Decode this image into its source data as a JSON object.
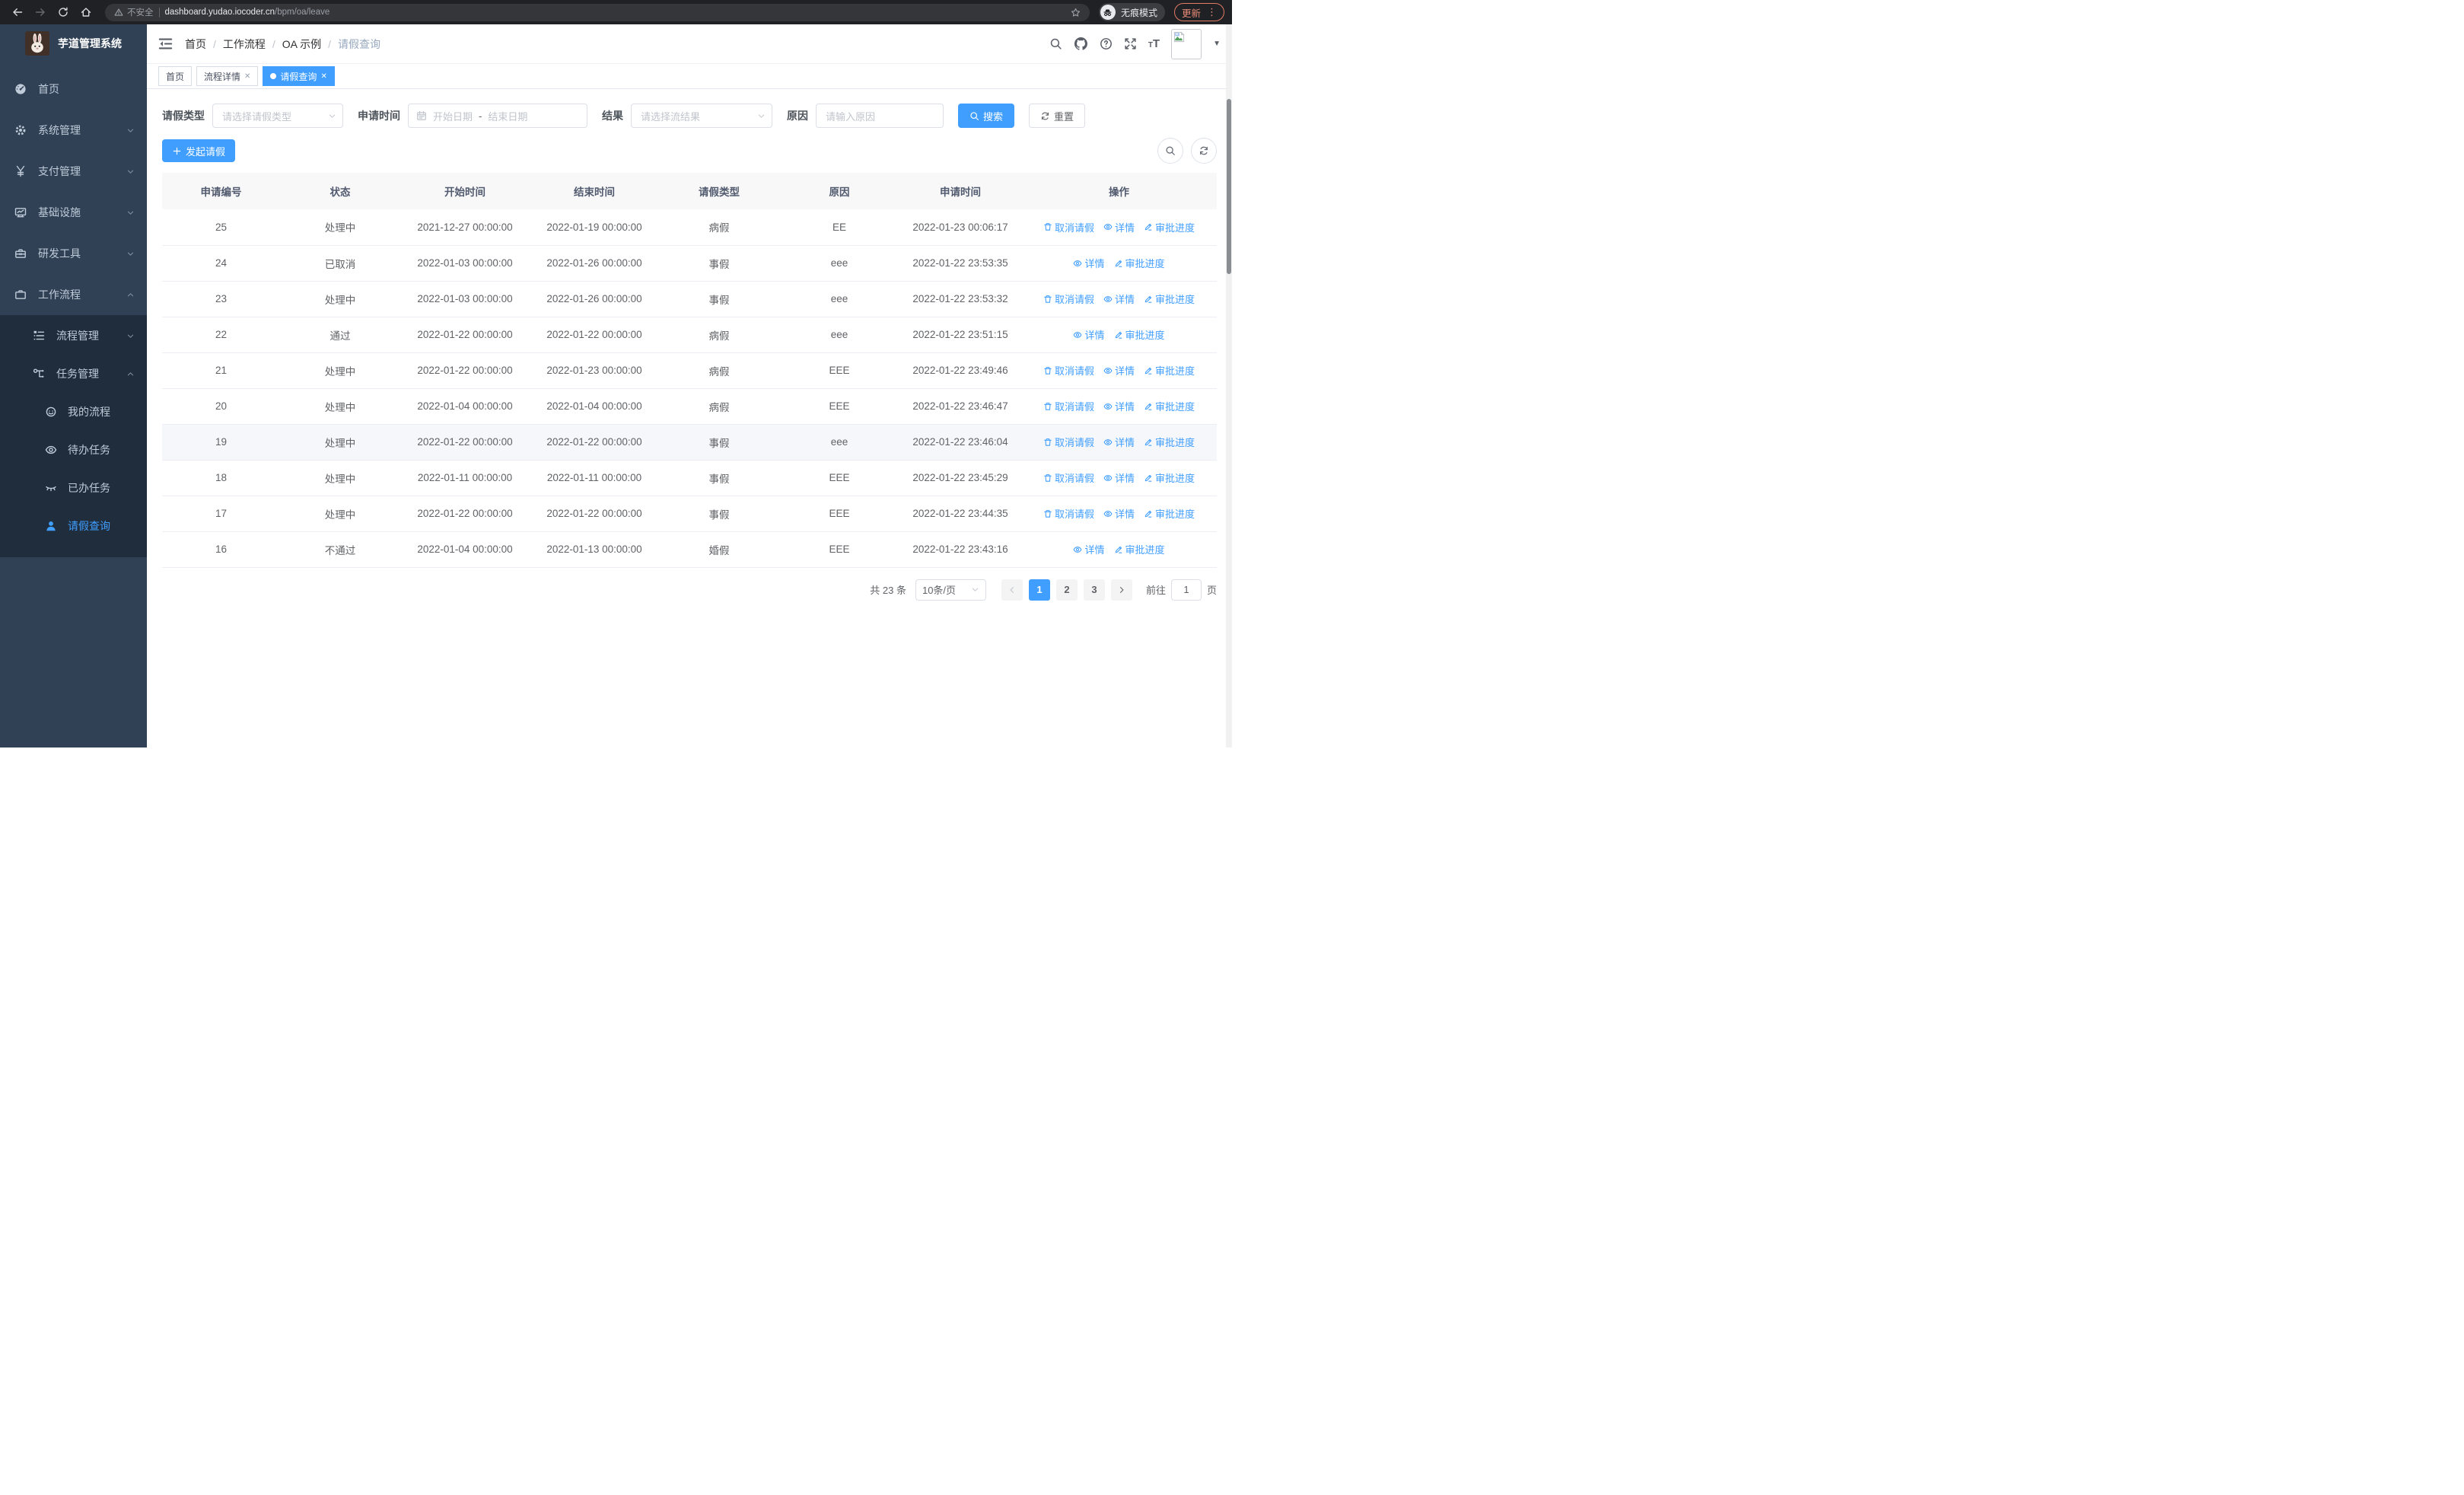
{
  "browser": {
    "security_text": "不安全",
    "url_main": "dashboard.yudao.iocoder.cn",
    "url_path": "/bpm/oa/leave",
    "incognito_label": "无痕模式",
    "update_label": "更新"
  },
  "sidebar": {
    "logo_title": "芋道管理系统",
    "items": [
      {
        "label": "首页",
        "icon": "dashboard-icon",
        "level": 0,
        "chevron": null,
        "group": "top"
      },
      {
        "label": "系统管理",
        "icon": "gear-icon",
        "level": 0,
        "chevron": "down",
        "group": "top"
      },
      {
        "label": "支付管理",
        "icon": "yen-icon",
        "level": 0,
        "chevron": "down",
        "group": "top"
      },
      {
        "label": "基础设施",
        "icon": "monitor-icon",
        "level": 0,
        "chevron": "down",
        "group": "top"
      },
      {
        "label": "研发工具",
        "icon": "toolbox-icon",
        "level": 0,
        "chevron": "down",
        "group": "top"
      },
      {
        "label": "工作流程",
        "icon": "briefcase-icon",
        "level": 0,
        "chevron": "up",
        "group": "top"
      },
      {
        "label": "流程管理",
        "icon": "list-tree-icon",
        "level": 1,
        "chevron": "down",
        "group": "sub"
      },
      {
        "label": "任务管理",
        "icon": "flow-icon",
        "level": 1,
        "chevron": "up",
        "group": "sub"
      },
      {
        "label": "我的流程",
        "icon": "face-icon",
        "level": 2,
        "chevron": null,
        "group": "sub"
      },
      {
        "label": "待办任务",
        "icon": "eye-icon",
        "level": 2,
        "chevron": null,
        "group": "sub"
      },
      {
        "label": "已办任务",
        "icon": "eye-closed-icon",
        "level": 2,
        "chevron": null,
        "group": "sub"
      },
      {
        "label": "请假查询",
        "icon": "user-icon",
        "level": 2,
        "chevron": null,
        "group": "sub",
        "active": true
      }
    ]
  },
  "header": {
    "breadcrumb": [
      "首页",
      "工作流程",
      "OA 示例",
      "请假查询"
    ]
  },
  "tabs": [
    {
      "label": "首页",
      "closable": false,
      "active": false
    },
    {
      "label": "流程详情",
      "closable": true,
      "active": false
    },
    {
      "label": "请假查询",
      "closable": true,
      "active": true
    }
  ],
  "filters": {
    "leave_type_label": "请假类型",
    "leave_type_placeholder": "请选择请假类型",
    "apply_time_label": "申请时间",
    "date_start_placeholder": "开始日期",
    "date_separator": "-",
    "date_end_placeholder": "结束日期",
    "result_label": "结果",
    "result_placeholder": "请选择流结果",
    "reason_label": "原因",
    "reason_placeholder": "请输入原因",
    "search_label": "搜索",
    "reset_label": "重置"
  },
  "toolbar": {
    "create_label": "发起请假"
  },
  "table": {
    "columns": [
      "申请编号",
      "状态",
      "开始时间",
      "结束时间",
      "请假类型",
      "原因",
      "申请时间",
      "操作"
    ],
    "action_labels": {
      "cancel": "取消请假",
      "detail": "详情",
      "progress": "审批进度"
    },
    "rows": [
      {
        "id": "25",
        "status": "处理中",
        "start": "2021-12-27 00:00:00",
        "end": "2022-01-19 00:00:00",
        "type": "病假",
        "reason": "EE",
        "applied": "2022-01-23 00:06:17",
        "actions": [
          "cancel",
          "detail",
          "progress"
        ],
        "highlighted": false
      },
      {
        "id": "24",
        "status": "已取消",
        "start": "2022-01-03 00:00:00",
        "end": "2022-01-26 00:00:00",
        "type": "事假",
        "reason": "eee",
        "applied": "2022-01-22 23:53:35",
        "actions": [
          "detail",
          "progress"
        ],
        "highlighted": false
      },
      {
        "id": "23",
        "status": "处理中",
        "start": "2022-01-03 00:00:00",
        "end": "2022-01-26 00:00:00",
        "type": "事假",
        "reason": "eee",
        "applied": "2022-01-22 23:53:32",
        "actions": [
          "cancel",
          "detail",
          "progress"
        ],
        "highlighted": false
      },
      {
        "id": "22",
        "status": "通过",
        "start": "2022-01-22 00:00:00",
        "end": "2022-01-22 00:00:00",
        "type": "病假",
        "reason": "eee",
        "applied": "2022-01-22 23:51:15",
        "actions": [
          "detail",
          "progress"
        ],
        "highlighted": false
      },
      {
        "id": "21",
        "status": "处理中",
        "start": "2022-01-22 00:00:00",
        "end": "2022-01-23 00:00:00",
        "type": "病假",
        "reason": "EEE",
        "applied": "2022-01-22 23:49:46",
        "actions": [
          "cancel",
          "detail",
          "progress"
        ],
        "highlighted": false
      },
      {
        "id": "20",
        "status": "处理中",
        "start": "2022-01-04 00:00:00",
        "end": "2022-01-04 00:00:00",
        "type": "病假",
        "reason": "EEE",
        "applied": "2022-01-22 23:46:47",
        "actions": [
          "cancel",
          "detail",
          "progress"
        ],
        "highlighted": false
      },
      {
        "id": "19",
        "status": "处理中",
        "start": "2022-01-22 00:00:00",
        "end": "2022-01-22 00:00:00",
        "type": "事假",
        "reason": "eee",
        "applied": "2022-01-22 23:46:04",
        "actions": [
          "cancel",
          "detail",
          "progress"
        ],
        "highlighted": true
      },
      {
        "id": "18",
        "status": "处理中",
        "start": "2022-01-11 00:00:00",
        "end": "2022-01-11 00:00:00",
        "type": "事假",
        "reason": "EEE",
        "applied": "2022-01-22 23:45:29",
        "actions": [
          "cancel",
          "detail",
          "progress"
        ],
        "highlighted": false
      },
      {
        "id": "17",
        "status": "处理中",
        "start": "2022-01-22 00:00:00",
        "end": "2022-01-22 00:00:00",
        "type": "事假",
        "reason": "EEE",
        "applied": "2022-01-22 23:44:35",
        "actions": [
          "cancel",
          "detail",
          "progress"
        ],
        "highlighted": false
      },
      {
        "id": "16",
        "status": "不通过",
        "start": "2022-01-04 00:00:00",
        "end": "2022-01-13 00:00:00",
        "type": "婚假",
        "reason": "EEE",
        "applied": "2022-01-22 23:43:16",
        "actions": [
          "detail",
          "progress"
        ],
        "highlighted": false
      }
    ]
  },
  "pagination": {
    "total_text": "共 23 条",
    "page_size_text": "10条/页",
    "pages": [
      "1",
      "2",
      "3"
    ],
    "active_page": "1",
    "goto_label": "前往",
    "goto_value": "1",
    "goto_suffix": "页"
  },
  "colors": {
    "accent": "#409eff",
    "sidebar_bg": "#304156",
    "submenu_bg": "#1f2d3d",
    "update_button": "#e88b76",
    "table_header_bg": "#f8f8f9"
  }
}
